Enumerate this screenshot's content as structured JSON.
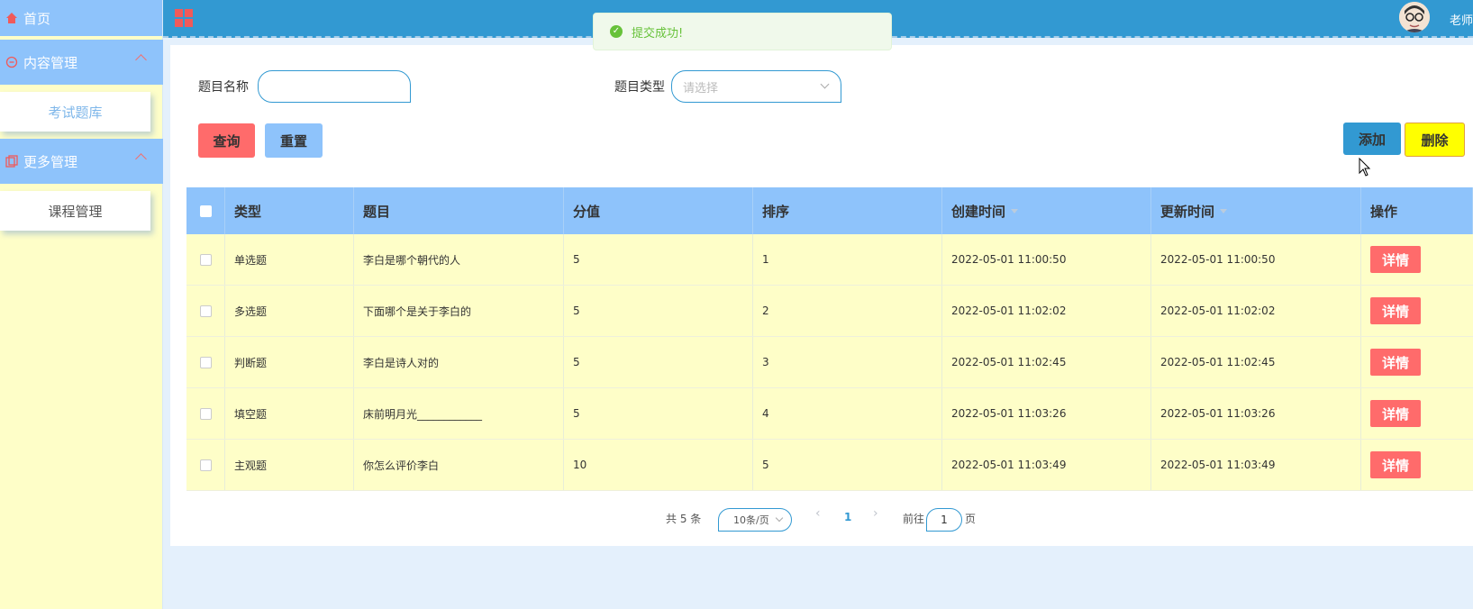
{
  "sidebar": {
    "home": "首页",
    "groups": [
      {
        "label": "内容管理",
        "items": [
          "考试题库"
        ]
      },
      {
        "label": "更多管理",
        "items": [
          "课程管理"
        ]
      }
    ]
  },
  "header": {
    "user": "老师"
  },
  "toast": {
    "message": "提交成功!"
  },
  "search": {
    "name_label": "题目名称",
    "name_value": "",
    "type_label": "题目类型",
    "type_placeholder": "请选择",
    "query_btn": "查询",
    "reset_btn": "重置",
    "add_btn": "添加",
    "delete_btn": "删除"
  },
  "table": {
    "columns": [
      "类型",
      "题目",
      "分值",
      "排序",
      "创建时间",
      "更新时间",
      "操作"
    ],
    "detail_label": "详情",
    "rows": [
      [
        "单选题",
        "李白是哪个朝代的人",
        "5",
        "1",
        "2022-05-01 11:00:50",
        "2022-05-01 11:00:50"
      ],
      [
        "多选题",
        "下面哪个是关于李白的",
        "5",
        "2",
        "2022-05-01 11:02:02",
        "2022-05-01 11:02:02"
      ],
      [
        "判断题",
        "李白是诗人对的",
        "5",
        "3",
        "2022-05-01 11:02:45",
        "2022-05-01 11:02:45"
      ],
      [
        "填空题",
        "床前明月光____________",
        "5",
        "4",
        "2022-05-01 11:03:26",
        "2022-05-01 11:03:26"
      ],
      [
        "主观题",
        "你怎么评价李白",
        "10",
        "5",
        "2022-05-01 11:03:49",
        "2022-05-01 11:03:49"
      ]
    ]
  },
  "pager": {
    "total": "共 5 条",
    "page_size": "10条/页",
    "current_page": "1",
    "goto_prefix": "前往",
    "goto_value": "1",
    "goto_suffix": "页"
  },
  "colors": {
    "header": "#3299d2",
    "sidebar_menu": "#8ec3fb",
    "sidebar_bg": "#fefec8",
    "danger": "#ff6b6b",
    "warning": "#ffff00",
    "success": "#67c23a"
  }
}
